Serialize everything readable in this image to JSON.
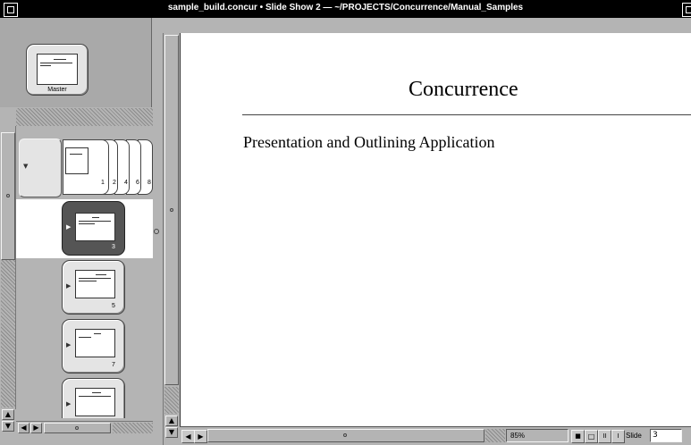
{
  "window": {
    "title": "sample_build.concur • Slide Show 2 — ~/PROJECTS/Concurrence/Manual_Samples"
  },
  "master": {
    "label": "Master"
  },
  "filmstrip": {
    "group_numbers": [
      "1",
      "2",
      "4",
      "6",
      "8"
    ],
    "slides": [
      {
        "number": "3",
        "selected": true
      },
      {
        "number": "5",
        "selected": false
      },
      {
        "number": "7",
        "selected": false
      },
      {
        "number": "",
        "selected": false
      }
    ]
  },
  "slide": {
    "title": "Concurrence",
    "subtitle": "Presentation and Outlining Application"
  },
  "statusbar": {
    "zoom": "85%",
    "slide_label": "Slide",
    "slide_number": "3"
  },
  "colors": {
    "titlebar": "#000000",
    "panel": "#b4b4b4",
    "selected_row": "#ffffff",
    "selected_card": "#555555",
    "canvas": "#ffffff"
  }
}
